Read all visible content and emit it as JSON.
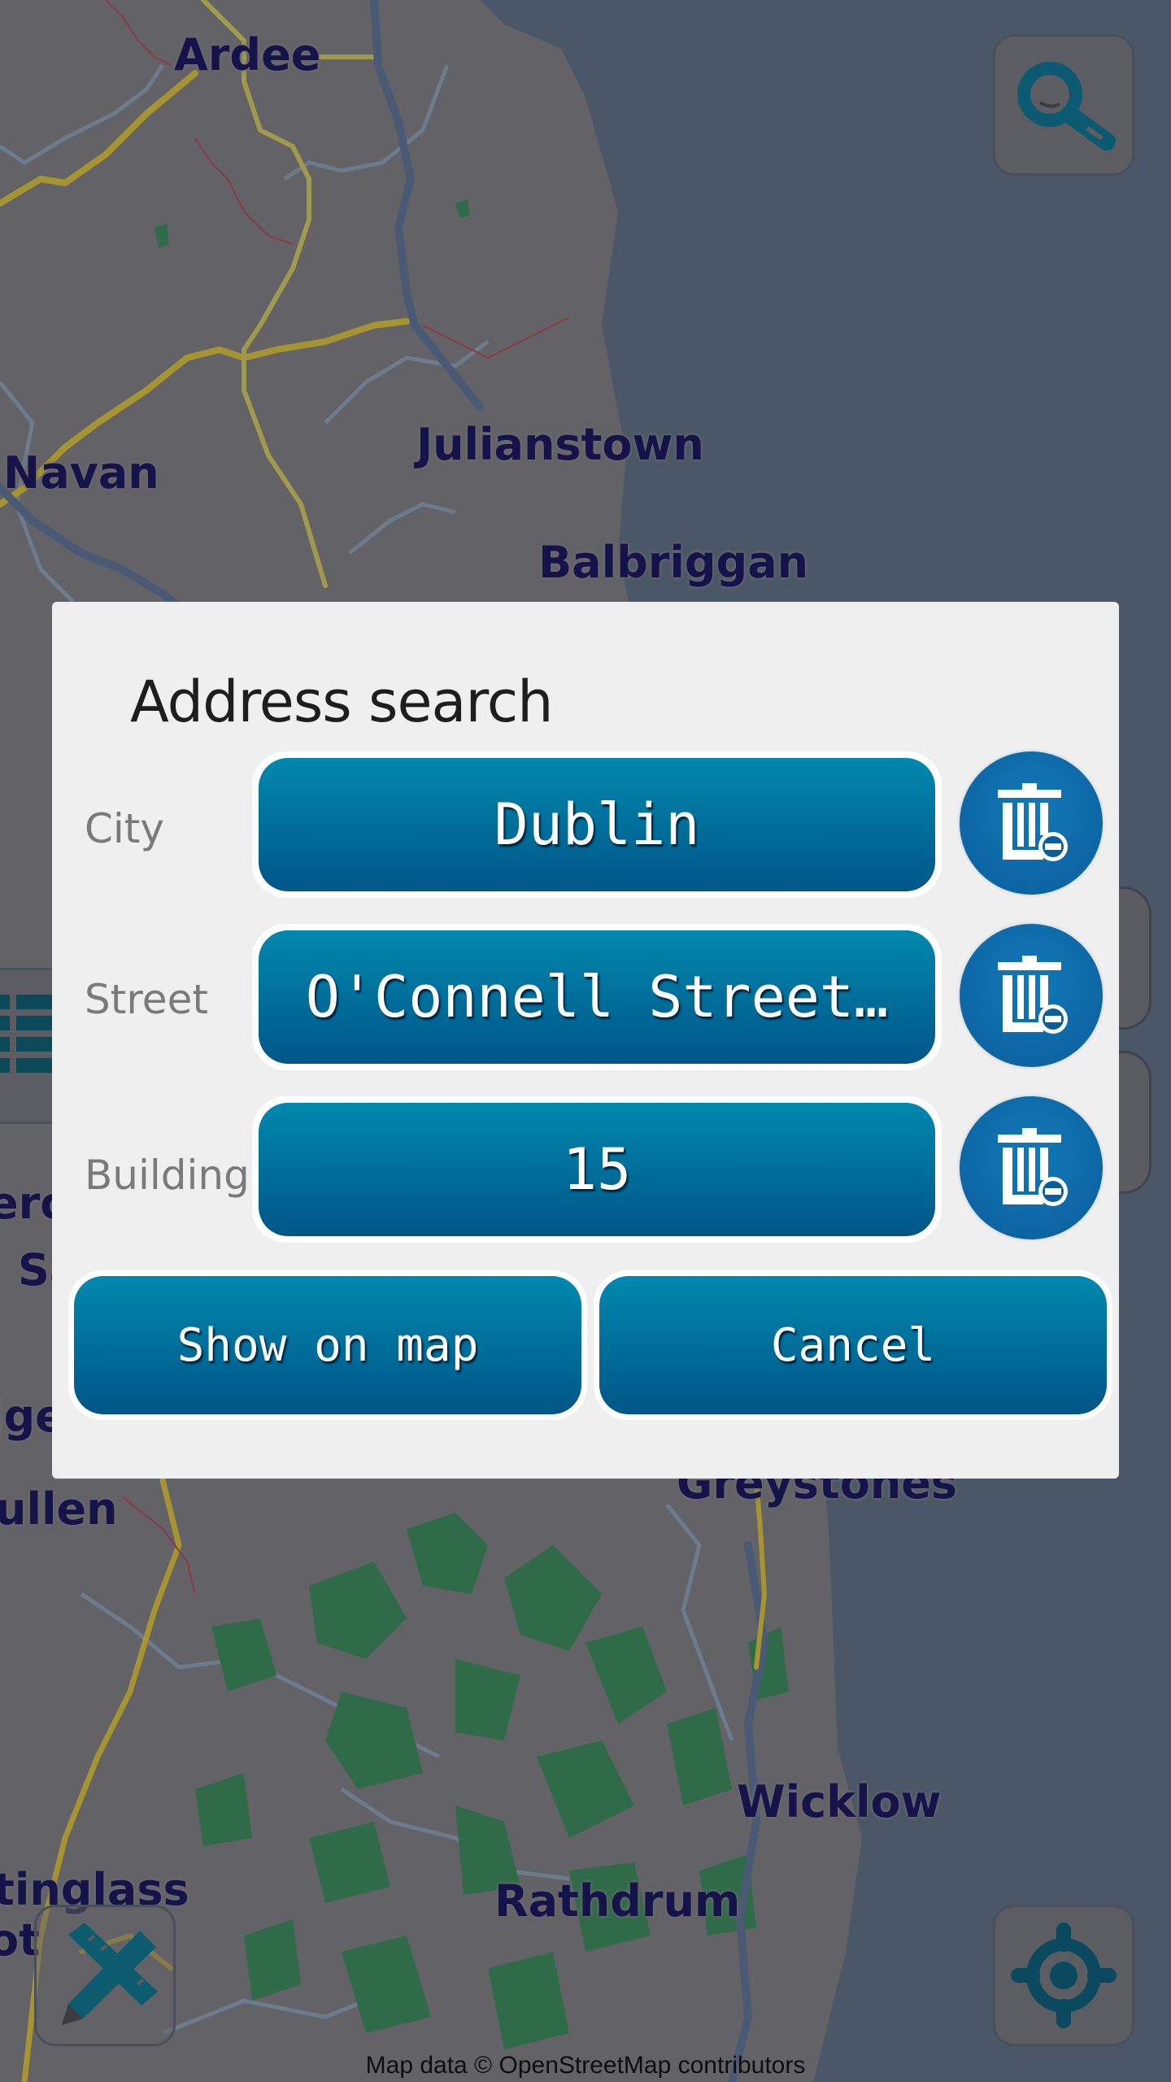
{
  "map": {
    "labels": [
      {
        "id": "ardee",
        "text": "Ardee"
      },
      {
        "id": "navan",
        "text": "Navan"
      },
      {
        "id": "julianstown",
        "text": "Julianstown"
      },
      {
        "id": "balbriggan",
        "text": "Balbriggan"
      },
      {
        "id": "greystones",
        "text": "Greystones"
      },
      {
        "id": "wicklow",
        "text": "Wicklow"
      },
      {
        "id": "rathdrum",
        "text": "Rathdrum"
      },
      {
        "id": "baltinglass",
        "text": "tinglass"
      },
      {
        "id": "dunlavin",
        "text": "ullen"
      },
      {
        "id": "partial-ot",
        "text": "ot"
      },
      {
        "id": "partial-ero",
        "text": "ero"
      },
      {
        "id": "partial-sa",
        "text": "Sa"
      },
      {
        "id": "partial-lge",
        "text": "lge"
      }
    ],
    "attribution": "Map data © OpenStreetMap contributors",
    "colors": {
      "land": "#636266",
      "sea": "#4a5766",
      "forest": "#2f6b48",
      "road_major": "#b8a13a",
      "motorway": "#4b5a74"
    }
  },
  "controls": {
    "search_icon": "search-icon",
    "locate_icon": "crosshair-icon",
    "measure_icon": "ruler-pencil-icon",
    "layers_icon": "layers-icon"
  },
  "dialog": {
    "title": "Address search",
    "fields": [
      {
        "label": "City",
        "value": "Dublin",
        "clear_icon": "trash-icon"
      },
      {
        "label": "Street",
        "value": "O'Connell Street…",
        "clear_icon": "trash-icon"
      },
      {
        "label": "Building",
        "value": "15",
        "clear_icon": "trash-icon"
      }
    ],
    "show_on_map_label": "Show on map",
    "cancel_label": "Cancel",
    "accent_color": "#0177a4"
  }
}
